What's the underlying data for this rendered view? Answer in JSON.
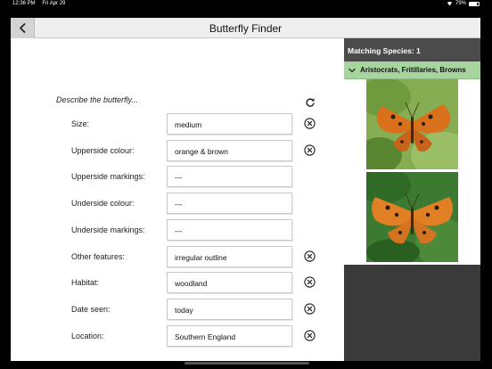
{
  "status_bar": {
    "time": "12:36 PM",
    "date": "Fri Apr 29",
    "battery": "79%",
    "battery_level": 0.79
  },
  "navbar": {
    "title": "Butterfly Finder",
    "back_icon": "chevron-left-icon"
  },
  "form": {
    "prompt": "Describe the butterfly...",
    "reset_icon": "refresh-icon",
    "fields": [
      {
        "label": "Size:",
        "value": "medium",
        "clearable": true
      },
      {
        "label": "Upperside colour:",
        "value": "orange & brown",
        "clearable": true
      },
      {
        "label": "Upperside markings:",
        "value": "---",
        "clearable": false
      },
      {
        "label": "Underside colour:",
        "value": "---",
        "clearable": false
      },
      {
        "label": "Underside markings:",
        "value": "---",
        "clearable": false
      },
      {
        "label": "Other features:",
        "value": "irregular outline",
        "clearable": true
      },
      {
        "label": "Habitat:",
        "value": "woodland",
        "clearable": true
      },
      {
        "label": "Date seen:",
        "value": "today",
        "clearable": true
      },
      {
        "label": "Location:",
        "value": "Southern England",
        "clearable": true
      }
    ]
  },
  "species_panel": {
    "header": "Matching Species: 1",
    "group": {
      "label": "Aristocrats, Fritillaries, Browns",
      "expanded_icon": "chevron-down-icon"
    },
    "images": [
      {
        "name": "comma-butterfly-upperside-photo",
        "wing_color": "#d8711c",
        "background": "#7fa64a"
      },
      {
        "name": "comma-butterfly-open-wings-photo",
        "wing_color": "#e17f24",
        "background": "#3f7a32"
      }
    ]
  }
}
